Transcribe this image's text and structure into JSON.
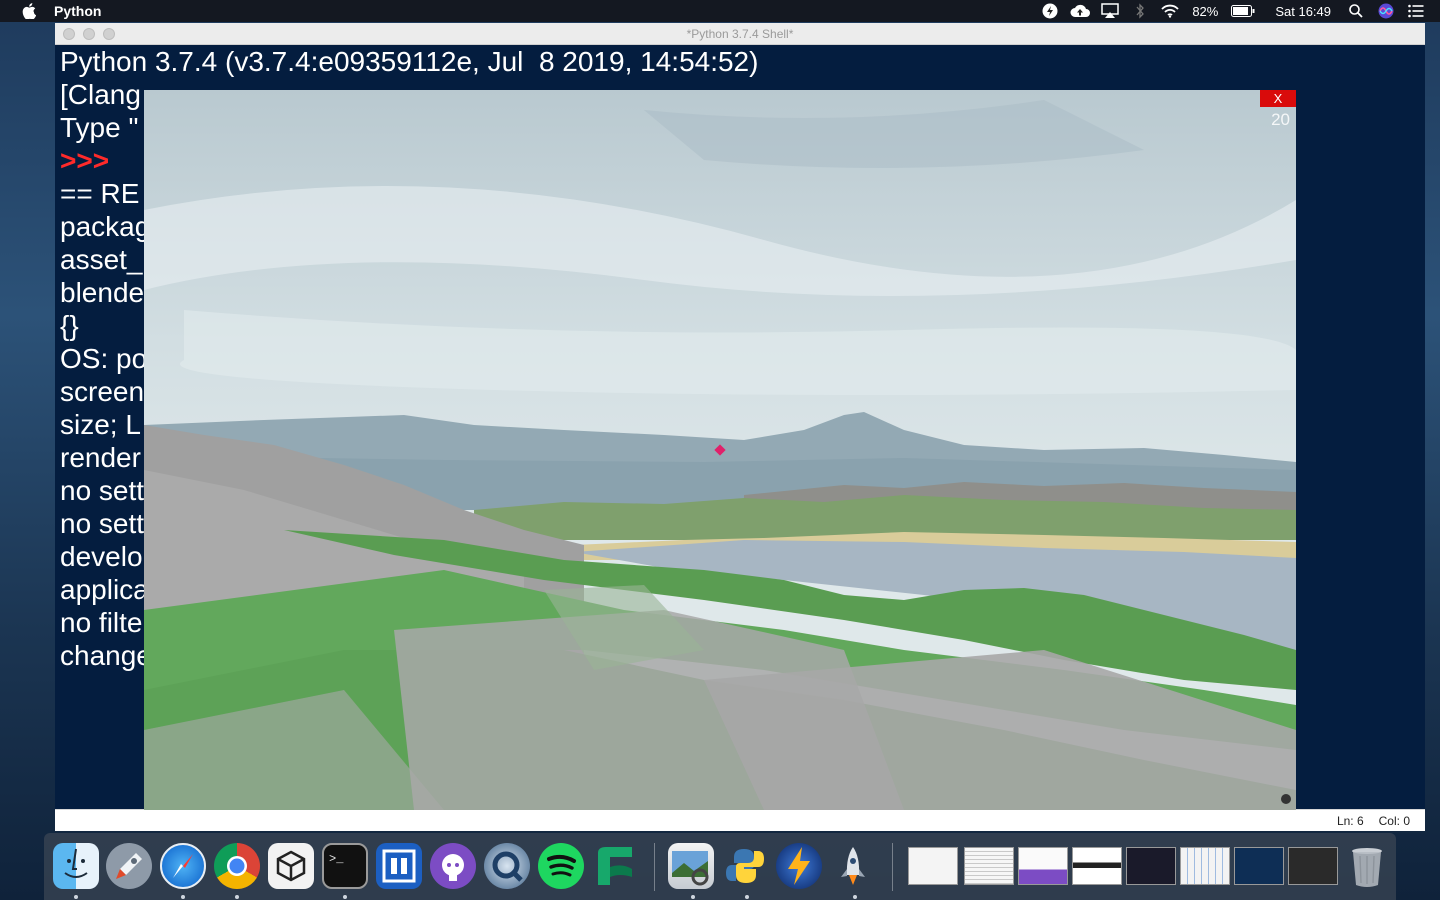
{
  "menubar": {
    "app_name": "Python",
    "battery_percent": "82%",
    "clock": "Sat 16:49",
    "icons": [
      "apple-icon",
      "power-icon",
      "cloud-upload-icon",
      "airplay-icon",
      "bluetooth-icon",
      "wifi-icon",
      "battery-icon",
      "spotlight-search-icon",
      "siri-icon",
      "notification-center-icon"
    ]
  },
  "window": {
    "title": "*Python 3.7.4 Shell*",
    "lines": [
      "Python 3.7.4 (v3.7.4:e09359112e, Jul  8 2019, 14:54:52)",
      "[Clang",
      "Type \"",
      ">>>",
      "== RE",
      "packag",
      "asset_",
      "blende",
      "{}",
      "OS: po",
      "screen",
      "size; L",
      "render",
      "no sett",
      "no sett",
      "develo",
      "applica",
      "no filte",
      "change"
    ],
    "status_line": "Ln: 6",
    "status_col": "Col: 0"
  },
  "game": {
    "close_label": "X",
    "fps": "20"
  },
  "dock": {
    "apps": [
      "finder-icon",
      "launchpad-icon",
      "safari-icon",
      "chrome-icon",
      "unity-icon",
      "terminal-icon",
      "sourcetree-icon",
      "github-desktop-icon",
      "quicktime-icon",
      "spotify-icon",
      "flowdock-icon",
      "preview-icon",
      "python-launcher-icon",
      "reeder-icon",
      "rocket-icon"
    ],
    "windows": [
      "window-thumbnail-document",
      "window-thumbnail-text",
      "window-thumbnail-github",
      "window-thumbnail-chrome",
      "window-thumbnail-video",
      "window-thumbnail-spreadsheet",
      "window-thumbnail-safari",
      "window-thumbnail-chrome-dark",
      "trash-icon"
    ]
  }
}
